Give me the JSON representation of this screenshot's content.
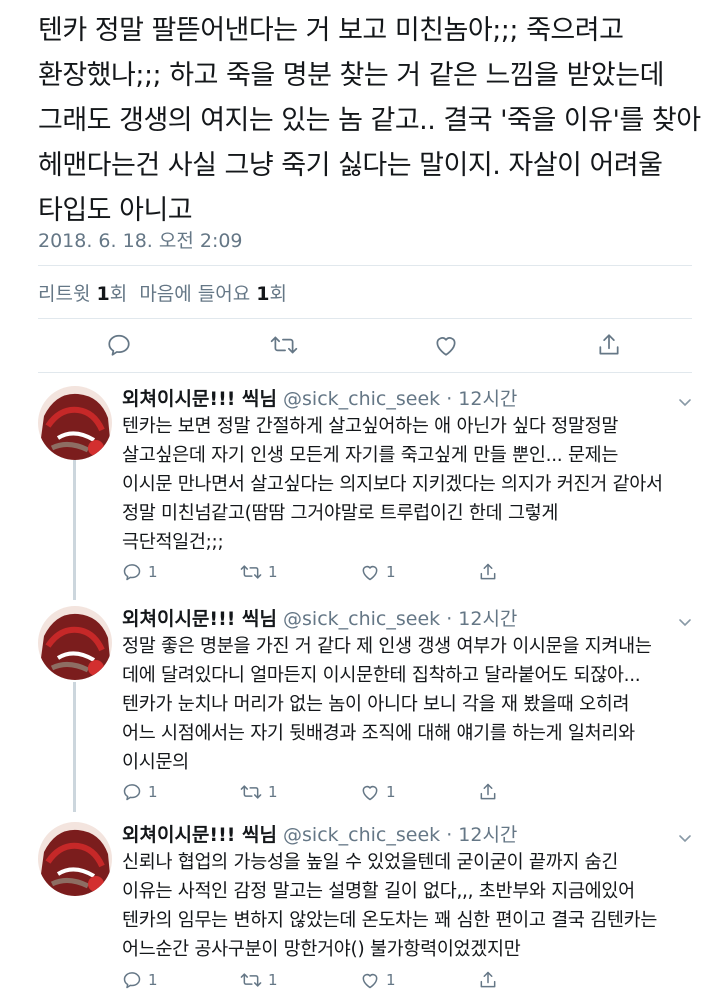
{
  "tweet": {
    "lines": [
      "텐카 정말 팔뜯어낸다는 거 보고 미친놈아;;; 죽으려고",
      "환장했나;;; 하고 죽을 명분 찾는 거 같은 느낌을 받았는데",
      "그래도 갱생의 여지는 있는 놈 같고.. 결국 '죽을 이유'를 찾아",
      "헤맨다는건 사실 그냥 죽기 싫다는 말이지. 자살이 어려울",
      "타입도 아니고"
    ],
    "timestamp": "2018. 6. 18. 오전 2:09",
    "retweet_label": "리트윗",
    "retweet_count": "1",
    "retweet_unit": "회",
    "like_label": "마음에 들어요",
    "like_count": "1",
    "like_unit": "회"
  },
  "replies": [
    {
      "name": "외쳐이시문!!! 씩님",
      "handle": "@sick_chic_seek · 12시간",
      "lines": [
        "텐카는 보면 정말 간절하게 살고싶어하는 애 아닌가 싶다 정말정말",
        "살고싶은데 자기 인생 모든게 자기를 죽고싶게 만들 뿐인... 문제는",
        "이시문 만나면서 살고싶다는 의지보다 지키겠다는 의지가 커진거 같아서",
        "정말 미친넘같고(땀땀 그거야말로 트루럽이긴 한데 그렇게",
        "극단적일건;;;"
      ],
      "reply_count": "1",
      "retweet_count": "1",
      "like_count": "1"
    },
    {
      "name": "외쳐이시문!!! 씩님",
      "handle": "@sick_chic_seek · 12시간",
      "lines": [
        "정말 좋은 명분을 가진 거 같다 제 인생 갱생 여부가 이시문을 지켜내는",
        "데에 달려있다니 얼마든지 이시문한테 집착하고 달라붙어도 되잖아...",
        "텐카가 눈치나 머리가 없는 놈이 아니다 보니 각을 재 봤을때 오히려",
        "어느 시점에서는 자기 뒷배경과 조직에 대해 얘기를 하는게 일처리와",
        "이시문의"
      ],
      "reply_count": "1",
      "retweet_count": "1",
      "like_count": "1"
    },
    {
      "name": "외쳐이시문!!! 씩님",
      "handle": "@sick_chic_seek · 12시간",
      "lines": [
        "신뢰나 협업의 가능성을 높일 수 있었을텐데 굳이굳이 끝까지 숨긴",
        "이유는 사적인 감정 말고는 설명할 길이 없다,,, 초반부와 지금에있어",
        "텐카의 임무는 변하지 않았는데 온도차는 꽤 심한 편이고 결국 김텐카는",
        "어느순간 공사구분이 망한거야() 불가항력이었겠지만"
      ],
      "reply_count": "1",
      "retweet_count": "1",
      "like_count": "1"
    }
  ],
  "colors": {
    "text": "#14171a",
    "secondary": "#657786",
    "divider": "#e1e8ed",
    "thread_line": "#ccd6dd"
  },
  "icons": [
    "reply-icon",
    "retweet-icon",
    "like-icon",
    "share-icon",
    "chevron-down-icon"
  ]
}
